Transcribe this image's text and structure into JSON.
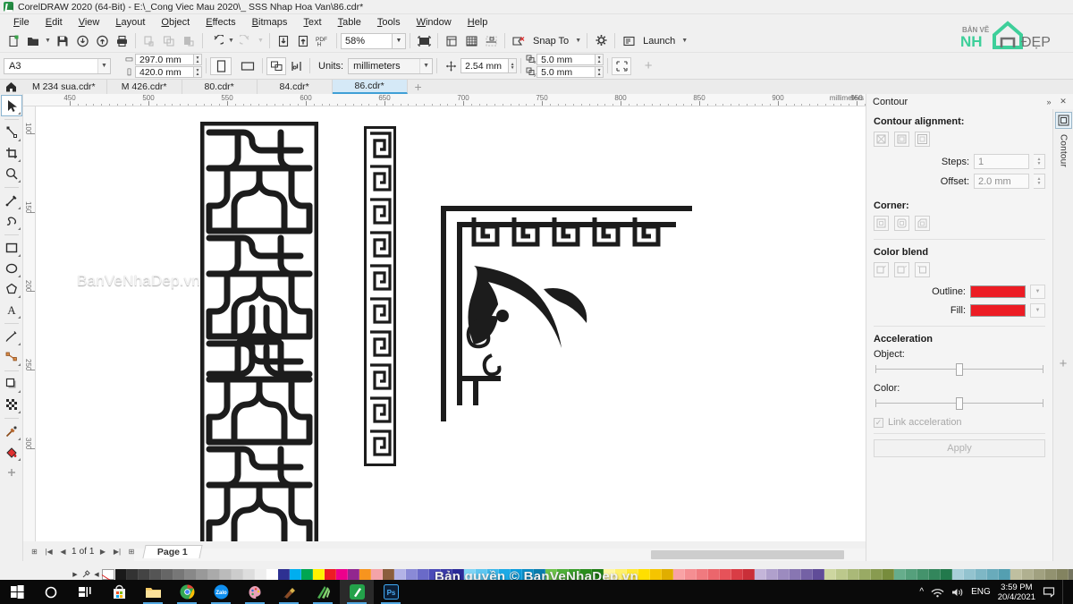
{
  "window": {
    "title": "CorelDRAW 2020 (64-Bit) - E:\\_Cong Viec Mau 2020\\_ SSS Nhap Hoa Van\\86.cdr*",
    "app_icon": "coreldraw-icon"
  },
  "menubar": {
    "items": [
      "File",
      "Edit",
      "View",
      "Layout",
      "Object",
      "Effects",
      "Bitmaps",
      "Text",
      "Table",
      "Tools",
      "Window",
      "Help"
    ]
  },
  "standard_toolbar": {
    "buttons": [
      {
        "name": "new-document-button",
        "icon": "new-page-icon"
      },
      {
        "name": "open-document-button",
        "icon": "folder-open-icon"
      },
      {
        "name": "save-button",
        "icon": "floppy-disk-icon"
      },
      {
        "name": "import-button",
        "icon": "import-arrow-icon"
      },
      {
        "name": "export-button",
        "icon": "export-arrow-icon"
      },
      {
        "name": "print-button",
        "icon": "printer-icon"
      },
      {
        "name": "cut-button",
        "icon": "scissors-icon"
      },
      {
        "name": "copy-button",
        "icon": "copy-icon"
      },
      {
        "name": "paste-button",
        "icon": "paste-icon"
      },
      {
        "name": "undo-button",
        "icon": "undo-arrow-icon"
      },
      {
        "name": "redo-button",
        "icon": "redo-arrow-icon"
      },
      {
        "name": "import-2-button",
        "icon": "down-into-box-icon"
      },
      {
        "name": "export-2-button",
        "icon": "up-out-of-box-icon"
      },
      {
        "name": "publish-pdf-button",
        "icon": "pdf-icon"
      }
    ],
    "zoom_level": "58%",
    "full_screen_label": "full-screen-preview",
    "snap_to_label": "Snap To",
    "options_label": "options-gear",
    "launch_label": "Launch"
  },
  "property_bar": {
    "page_size": "A3",
    "page_width": "297.0 mm",
    "page_height": "420.0 mm",
    "orientation_portrait": "portrait-icon",
    "orientation_landscape": "landscape-icon",
    "units_label": "Units:",
    "units_value": "millimeters",
    "nudge_value": "2.54 mm",
    "duplicate_x_label": "x",
    "duplicate_x": "5.0 mm",
    "duplicate_y_label": "y",
    "duplicate_y": "5.0 mm"
  },
  "document_tabs": {
    "home_icon": "home-icon",
    "tabs": [
      {
        "label": "M 234 sua.cdr*",
        "active": false
      },
      {
        "label": "M 426.cdr*",
        "active": false
      },
      {
        "label": "80.cdr*",
        "active": false
      },
      {
        "label": "84.cdr*",
        "active": false
      },
      {
        "label": "86.cdr*",
        "active": true
      }
    ],
    "add_tab": "+"
  },
  "toolbox": {
    "tools": [
      {
        "name": "pick-tool",
        "icon": "arrow-cursor-icon",
        "selected": true
      },
      {
        "name": "shape-tool",
        "icon": "node-edit-icon",
        "selected": false
      },
      {
        "name": "crop-tool",
        "icon": "crop-icon",
        "selected": false
      },
      {
        "name": "zoom-tool",
        "icon": "magnifier-icon",
        "selected": false
      },
      {
        "name": "freehand-tool",
        "icon": "pencil-line-icon",
        "selected": false
      },
      {
        "name": "artistic-media-tool",
        "icon": "brush-stroke-icon",
        "selected": false
      },
      {
        "name": "rectangle-tool",
        "icon": "rectangle-icon",
        "selected": false
      },
      {
        "name": "ellipse-tool",
        "icon": "ellipse-icon",
        "selected": false
      },
      {
        "name": "polygon-tool",
        "icon": "polygon-icon",
        "selected": false
      },
      {
        "name": "text-tool",
        "icon": "letter-a-icon",
        "selected": false
      },
      {
        "name": "parallel-dimension-tool",
        "icon": "dimension-line-icon",
        "selected": false
      },
      {
        "name": "straight-line-connector-tool",
        "icon": "connector-icon",
        "selected": false
      },
      {
        "name": "drop-shadow-tool",
        "icon": "drop-shadow-icon",
        "selected": false
      },
      {
        "name": "transparency-tool",
        "icon": "checkerboard-icon",
        "selected": false
      },
      {
        "name": "color-eyedropper-tool",
        "icon": "eyedropper-icon",
        "selected": false
      },
      {
        "name": "interactive-fill-tool",
        "icon": "paint-bucket-icon",
        "selected": false
      },
      {
        "name": "more-tools",
        "icon": "plus-icon",
        "selected": false
      }
    ]
  },
  "ruler": {
    "unit_label": "millimeters",
    "ticks": [
      450,
      500,
      550,
      600,
      650,
      700,
      750,
      800,
      850,
      900,
      950
    ],
    "vertical_ticks": [
      100,
      150,
      200,
      250,
      300
    ]
  },
  "canvas": {
    "watermark": "BanVeNhaDep.vn",
    "artwork": [
      {
        "name": "lattice-panel-pattern",
        "description": "Vietnamese lattice screen pattern"
      },
      {
        "name": "greek-key-border-strip",
        "description": "vertical meander border"
      },
      {
        "name": "dragon-corner-ornament",
        "description": "corner ornament with dragon and meander border"
      }
    ]
  },
  "docker": {
    "title": "Contour",
    "collapse_icon": "chevrons-right-icon",
    "close_icon": "close-x-icon",
    "rail_label": "Contour",
    "rail_icon": "contour-icon",
    "alignment_label": "Contour alignment:",
    "alignment_options": [
      "align-none",
      "align-center",
      "align-outside"
    ],
    "steps_label": "Steps:",
    "steps_value": "1",
    "offset_label": "Offset:",
    "offset_value": "2.0 mm",
    "corner_label": "Corner:",
    "corner_options": [
      "miter-corner",
      "round-corner",
      "bevel-corner"
    ],
    "color_blend_label": "Color blend",
    "blend_options": [
      "linear-blend",
      "clockwise-blend",
      "counterclockwise-blend"
    ],
    "outline_label": "Outline:",
    "outline_color": "#EC1C24",
    "fill_label": "Fill:",
    "fill_color": "#EC1C24",
    "acceleration_label": "Acceleration",
    "object_label": "Object:",
    "color_label": "Color:",
    "link_acceleration_label": "Link acceleration",
    "apply_label": "Apply"
  },
  "status_bar": {
    "page_current": "1",
    "page_of": "of",
    "page_total": "1",
    "page_tab": "Page 1",
    "palette_watermark": "Bản quyền © BanVeNhaDep.vn"
  },
  "logo": {
    "line1": "BẢN VẼ",
    "line2a": "NH",
    "line2b": "ĐẸP",
    "accent": "#3ecf9a"
  },
  "taskbar": {
    "items": [
      {
        "name": "start-button",
        "icon": "windows-logo-icon"
      },
      {
        "name": "cortana-search",
        "icon": "circle-icon"
      },
      {
        "name": "task-view",
        "icon": "task-view-icon"
      },
      {
        "name": "microsoft-store",
        "icon": "store-bag-icon"
      },
      {
        "name": "file-explorer",
        "icon": "folder-icon"
      },
      {
        "name": "chrome-browser",
        "icon": "chrome-icon"
      },
      {
        "name": "zalo-app",
        "icon": "zalo-icon"
      },
      {
        "name": "paint-app",
        "icon": "palette-icon"
      },
      {
        "name": "unikey-app",
        "icon": "unikey-icon"
      },
      {
        "name": "sketchup-app",
        "icon": "sketchup-icon"
      },
      {
        "name": "coreldraw-app",
        "icon": "coreldraw-icon"
      },
      {
        "name": "photoshop-app",
        "icon": "photoshop-icon"
      }
    ],
    "tray": {
      "chevron": "^",
      "network_icon": "wifi-icon",
      "volume_icon": "speaker-icon",
      "language": "ENG",
      "time": "3:59 PM",
      "date": "20/4/2021"
    }
  },
  "palette_colors": [
    "#ffffff00",
    "#1a1a1a",
    "#333333",
    "#444444",
    "#555555",
    "#666666",
    "#777777",
    "#888888",
    "#999999",
    "#aaaaaa",
    "#bbbbbb",
    "#cccccc",
    "#dddddd",
    "#eeeeee",
    "#ffffff",
    "#2e3192",
    "#00aeef",
    "#00a651",
    "#fff200",
    "#ed1c24",
    "#ec008c",
    "#92278f",
    "#f7941e",
    "#f4a3a8",
    "#8b5e3c",
    "#b3b3e6",
    "#8a8ad6",
    "#6a6ac8",
    "#4a4ab8",
    "#3a3aa8",
    "#2a2a98",
    "#7fd4f5",
    "#5ec6f0",
    "#3db8eb",
    "#1caae6",
    "#0b9cdc",
    "#0a8cc4",
    "#0a7cac",
    "#6cc24a",
    "#4faf3a",
    "#3a9e2c",
    "#2b8d1e",
    "#1f7c14",
    "#fff7a0",
    "#fff06a",
    "#ffe834",
    "#ffdf00",
    "#f5c400",
    "#e0ae00",
    "#f9a2a5",
    "#f58e92",
    "#f07a7f",
    "#eb666c",
    "#e65259",
    "#d93c45",
    "#c92f38",
    "#c4b5d9",
    "#b0a0cc",
    "#9c8bbf",
    "#8876b2",
    "#7461a5",
    "#604c98",
    "#cdd6a0",
    "#bcc88c",
    "#aab978",
    "#99aa64",
    "#889b50",
    "#778c3c",
    "#66ad8c",
    "#55a07c",
    "#44936c",
    "#33865c",
    "#22794c",
    "#a8cfd9",
    "#93c3cf",
    "#7eb7c5",
    "#69abbb",
    "#549fb1",
    "#bfbfa0",
    "#b0b090",
    "#a1a180",
    "#929270",
    "#838360",
    "#74745f",
    "#d9d9c0",
    "#cccbb0",
    "#bfbda0",
    "#b2af90",
    "#e8e4cf",
    "#ddd8bf"
  ]
}
